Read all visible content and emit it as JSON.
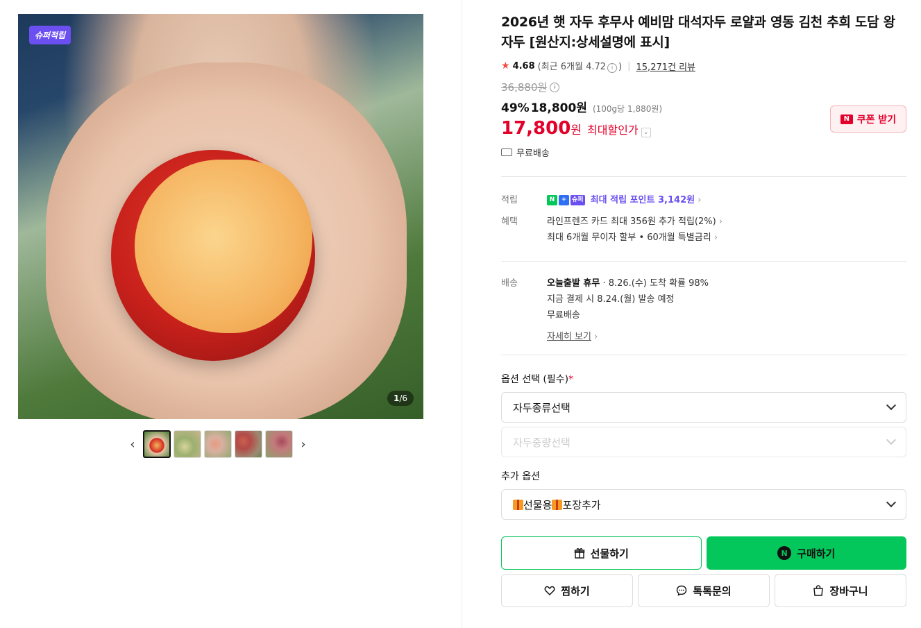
{
  "gallery": {
    "badge": "슈퍼적립",
    "counter_current": "1",
    "counter_total": "/6"
  },
  "product": {
    "title": "2026년 햇 자두 후무사 예비맘 대석자두 로얄과 영동 김천 추희 도담 왕자두 [원산지:상세설명에 표시]",
    "rating": "4.68",
    "recent_rating": "(최근 6개월 4.72",
    "recent_rating_close": ")",
    "review_count": "15,271건 리뷰",
    "original_price": "36,880원",
    "discount_rate": "49%",
    "sale_price": "18,800원",
    "unit_price": "(100g당 1,880원)",
    "max_price": "17,800",
    "max_won": "원",
    "max_label": "최대할인가",
    "coupon_label": "쿠폰 받기",
    "coupon_logo": "N",
    "shipping": "무료배송"
  },
  "benefits": {
    "point_key": "적립",
    "point_badges": [
      "N",
      "+",
      "슈퍼"
    ],
    "point_text": "최대 적립 포인트 3,142원",
    "benefit_key": "혜택",
    "benefit_line1": "라인프렌즈 카드 최대 356원 추가 적립(2%)",
    "benefit_line2": "최대 6개월 무이자 할부 • 60개월 특별금리"
  },
  "delivery": {
    "key": "배송",
    "line1_bold": "오늘출발 휴무",
    "line1_rest": "· 8.26.(수) 도착 확률 98%",
    "line2": "지금 결제 시 8.24.(월) 발송 예정",
    "line3": "무료배송",
    "details_link": "자세히 보기"
  },
  "options": {
    "label": "옵션 선택 (필수)",
    "required_mark": "*",
    "select1": "자두종류선택",
    "select2": "자두중량선택",
    "extra_label": "추가 옵션",
    "extra_select_a": "선물용",
    "extra_select_b": "포장추가"
  },
  "actions": {
    "gift": "선물하기",
    "buy": "구매하기",
    "buy_badge": "N",
    "wish": "찜하기",
    "talk": "톡톡문의",
    "cart": "장바구니"
  },
  "colors": {
    "accent_green": "#03c75a",
    "price_red": "#e3002b",
    "super_purple": "#6b4ff0"
  }
}
